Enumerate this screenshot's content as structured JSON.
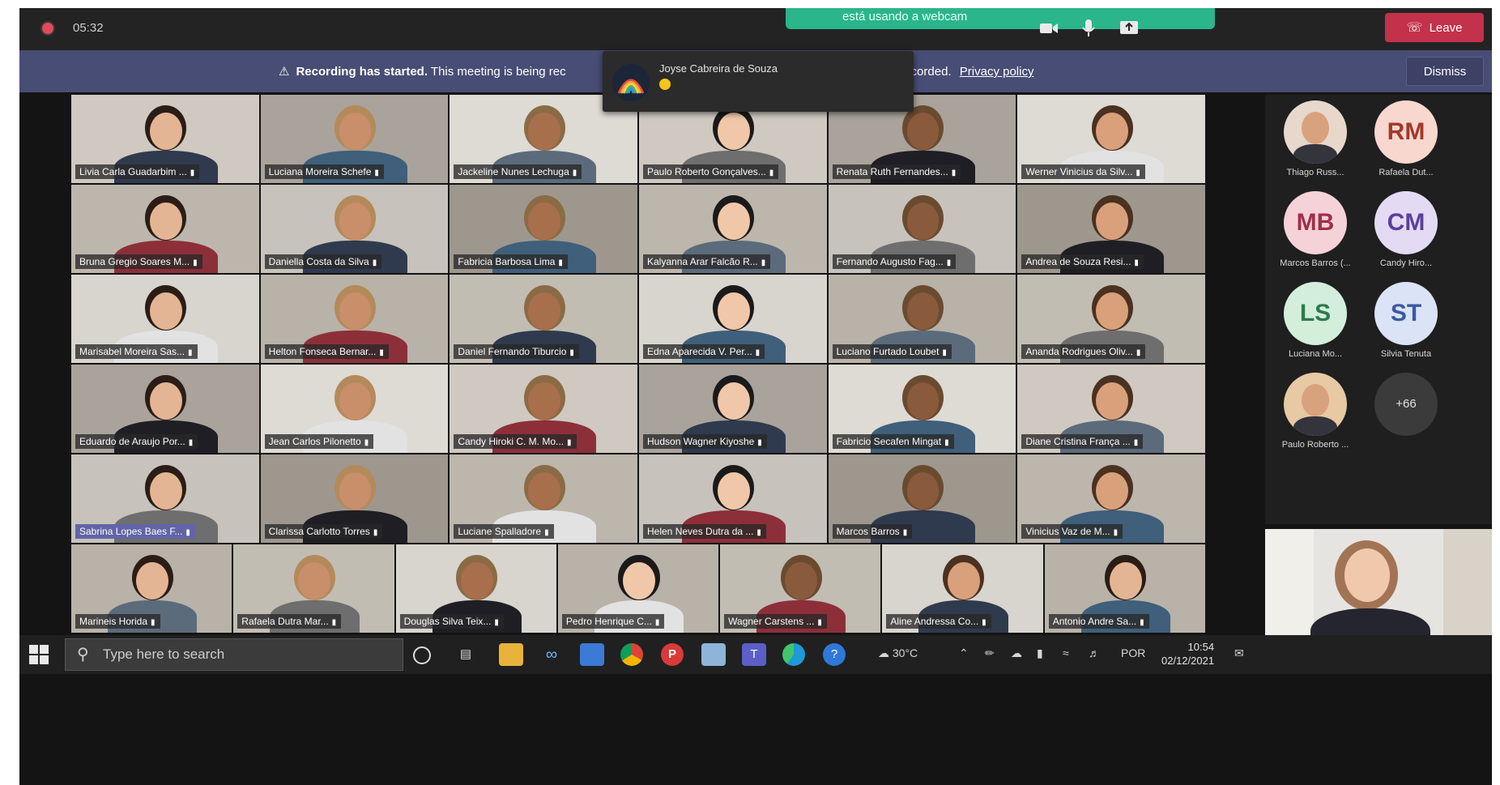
{
  "topbar": {
    "timer": "05:32",
    "webcam_notice": "está usando a webcam",
    "leave_label": "Leave"
  },
  "banner": {
    "bold": "Recording has started.",
    "text_start": "This meeting is being rec",
    "text_end": "eting to be recorded.",
    "link": "Privacy policy",
    "dismiss_label": "Dismiss"
  },
  "toast": {
    "name": "Joyse Cabreira de Souza"
  },
  "participants": [
    {
      "name": "Livia Carla Guadarbim ..."
    },
    {
      "name": "Luciana Moreira Schefe"
    },
    {
      "name": "Jackeline Nunes Lechuga"
    },
    {
      "name": "Paulo Roberto Gonçalves..."
    },
    {
      "name": "Renata Ruth Fernandes..."
    },
    {
      "name": "Werner Vinicius da Silv..."
    },
    {
      "name": "Bruna Gregio Soares M..."
    },
    {
      "name": "Daniella Costa da Silva"
    },
    {
      "name": "Fabricia Barbosa Lima"
    },
    {
      "name": "Kalyanna Arar Falcão R..."
    },
    {
      "name": "Fernando Augusto Fag..."
    },
    {
      "name": "Andrea de Souza Resi..."
    },
    {
      "name": "Marisabel Moreira Sas..."
    },
    {
      "name": "Helton Fonseca Bernar..."
    },
    {
      "name": "Daniel Fernando Tiburcio"
    },
    {
      "name": "Edna Aparecida V. Per..."
    },
    {
      "name": "Luciano Furtado Loubet"
    },
    {
      "name": "Ananda Rodrigues Oliv..."
    },
    {
      "name": "Eduardo de Araujo Por..."
    },
    {
      "name": "Jean Carlos Pilonetto"
    },
    {
      "name": "Candy Hiroki C. M. Mo..."
    },
    {
      "name": "Hudson Wagner Kiyoshe"
    },
    {
      "name": "Fabricio Secafen Mingat"
    },
    {
      "name": "Diane Cristina França ..."
    },
    {
      "name": "Sabrina Lopes Baes F..."
    },
    {
      "name": "Clarissa Carlotto Torres"
    },
    {
      "name": "Luciane Spalladore"
    },
    {
      "name": "Helen Neves Dutra da ..."
    },
    {
      "name": "Marcos Barros"
    },
    {
      "name": "Vinicius Vaz de M..."
    },
    {
      "name": "Marineis Horida"
    },
    {
      "name": "Rafaela Dutra Mar..."
    },
    {
      "name": "Douglas Silva Teix..."
    },
    {
      "name": "Pedro Henrique C..."
    },
    {
      "name": "Wagner Carstens ..."
    },
    {
      "name": "Aline Andressa Co..."
    },
    {
      "name": "Antonio Andre Sa..."
    }
  ],
  "side_participants": [
    {
      "initials": "",
      "label": "Thiago Russ..."
    },
    {
      "initials": "RM",
      "label": "Rafaela Dut..."
    },
    {
      "initials": "MB",
      "label": "Marcos Barros (..."
    },
    {
      "initials": "CM",
      "label": "Candy Hiro..."
    },
    {
      "initials": "LS",
      "label": "Luciana Mo..."
    },
    {
      "initials": "ST",
      "label": "Silvia Tenuta"
    },
    {
      "initials": "",
      "label": "Paulo Roberto ..."
    }
  ],
  "more_count": "+66",
  "taskbar": {
    "search_placeholder": "Type here to search",
    "weather": "30°C",
    "lang": "POR",
    "time": "10:54",
    "date": "02/12/2021"
  },
  "colors": {
    "leave": "#c4314b",
    "banner": "#484d75",
    "webcam_notice": "#2bb58a",
    "highlight_name": "#6264a7"
  }
}
